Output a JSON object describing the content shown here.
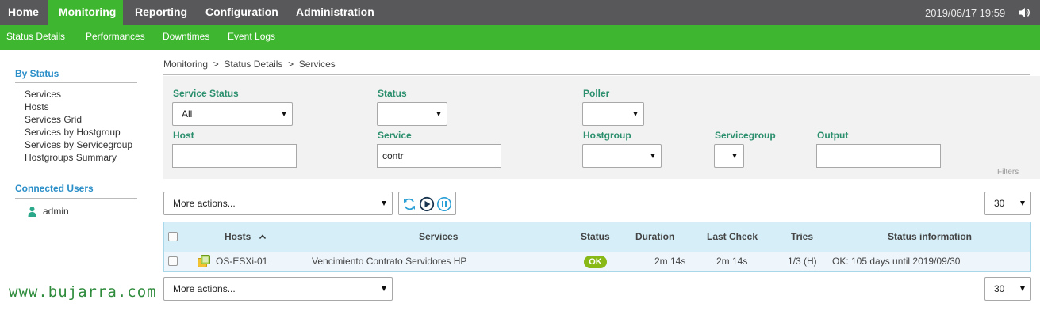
{
  "topnav": {
    "tabs": [
      "Home",
      "Monitoring",
      "Reporting",
      "Configuration",
      "Administration"
    ],
    "datetime": "2019/06/17 19:59"
  },
  "subnav": {
    "items": [
      "Status Details",
      "Performances",
      "Downtimes",
      "Event Logs"
    ]
  },
  "sidebar": {
    "by_status_title": "By Status",
    "links": [
      "Services",
      "Hosts",
      "Services Grid",
      "Services by Hostgroup",
      "Services by Servicegroup",
      "Hostgroups Summary"
    ],
    "connected_users_title": "Connected Users",
    "user": "admin"
  },
  "watermark": "www.bujarra.com",
  "breadcrumb": "Monitoring  >  Status Details  >  Services",
  "filters": {
    "service_status_label": "Service Status",
    "service_status_value": "All",
    "status_label": "Status",
    "poller_label": "Poller",
    "host_label": "Host",
    "host_value": "",
    "service_label": "Service",
    "service_value": "contr",
    "hostgroup_label": "Hostgroup",
    "servicegroup_label": "Servicegroup",
    "output_label": "Output",
    "output_value": "",
    "filters_link": "Filters"
  },
  "actions": {
    "more_actions": "More actions...",
    "per_page": "30"
  },
  "table": {
    "headers": [
      "Hosts",
      "Services",
      "Status",
      "Duration",
      "Last Check",
      "Tries",
      "Status information"
    ],
    "rows": [
      {
        "host": "OS-ESXi-01",
        "service": "Vencimiento Contrato Servidores HP",
        "status": "OK",
        "duration": "2m 14s",
        "last_check": "2m 14s",
        "tries": "1/3 (H)",
        "info": "OK: 105 days until 2019/09/30"
      }
    ]
  },
  "colors": {
    "nav_bg": "#58585a",
    "accent_green": "#3fb62f",
    "label_green": "#2b8f6e",
    "link_blue": "#2a8ec8",
    "ok_badge": "#88b917",
    "table_header": "#d5eef8"
  }
}
